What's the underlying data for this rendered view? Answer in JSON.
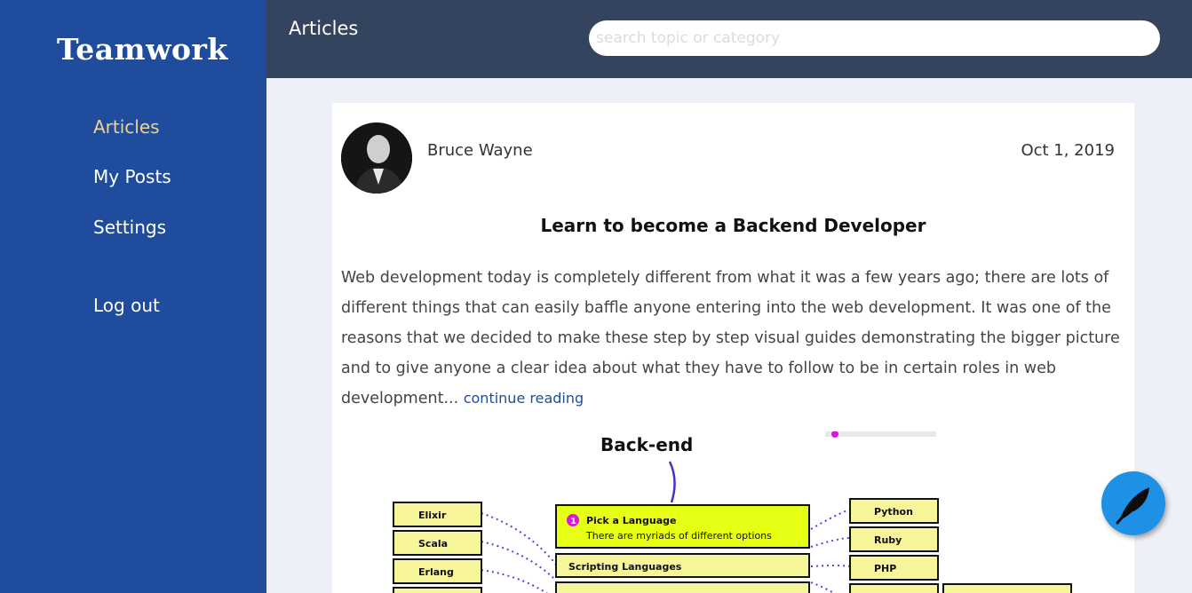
{
  "sidebar": {
    "brand": "Teamwork",
    "items": [
      {
        "label": "Articles",
        "active": true
      },
      {
        "label": "My Posts"
      },
      {
        "label": "Settings"
      }
    ],
    "logout_label": "Log out"
  },
  "header": {
    "title": "Articles",
    "search_placeholder": "search topic or category"
  },
  "post": {
    "author": "Bruce Wayne",
    "date": "Oct 1, 2019",
    "title": "Learn to become a Backend Developer",
    "excerpt": "Web development today is completely different from what it was a few years ago; there are lots of different things that can easily baffle anyone entering into the web development. It was one of the reasons that we decided to make these step by step visual guides demonstrating the bigger picture and to give anyone a clear idea about what they have to follow to be in certain roles in web development...",
    "continue_label": "continue reading",
    "image": {
      "heading": "Back-end",
      "step_number": "1",
      "step_title": "Pick a Language",
      "step_subtitle": "There are myriads of different options",
      "middle_box": "Scripting Languages",
      "left_items": [
        "Elixir",
        "Scala",
        "Erlang"
      ],
      "right_items": [
        "Python",
        "Ruby",
        "PHP"
      ]
    }
  },
  "fab": {
    "icon": "feather-icon"
  },
  "colors": {
    "sidebar": "#1f4c9c",
    "topbar": "#34445e",
    "accent": "#f3d28a",
    "fab": "#1e90e6"
  }
}
